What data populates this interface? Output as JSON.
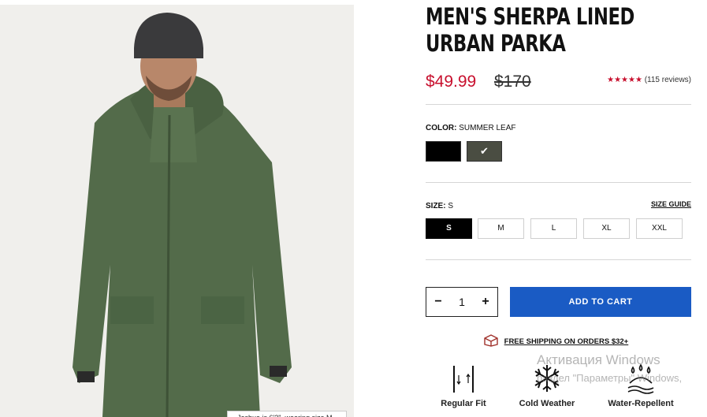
{
  "product": {
    "title_line1": "MEN'S SHERPA LINED",
    "title_line2": "URBAN PARKA",
    "price_sale": "$49.99",
    "price_original": "$170",
    "stars": "★★★★★",
    "reviews": "(115 reviews)",
    "image_caption": "Joshua is 6'2\", wearing size M"
  },
  "color": {
    "label": "COLOR:",
    "selected": "SUMMER LEAF",
    "swatches": [
      {
        "name": "black",
        "color": "#000000",
        "selected": false
      },
      {
        "name": "summer-leaf",
        "color": "#4a4d42",
        "selected": true
      }
    ],
    "check": "✔"
  },
  "size": {
    "label": "SIZE:",
    "selected": "S",
    "guide": "SIZE GUIDE",
    "options": [
      "S",
      "M",
      "L",
      "XL",
      "XXL"
    ]
  },
  "cart": {
    "qty_minus": "−",
    "qty_value": "1",
    "qty_plus": "+",
    "add_label": "ADD TO CART"
  },
  "shipping": "FREE SHIPPING ON ORDERS $32+",
  "features": [
    {
      "label": "Regular Fit",
      "icon": "regular-fit-icon"
    },
    {
      "label": "Cold Weather",
      "icon": "snowflake-icon"
    },
    {
      "label": "Water-Repellent",
      "icon": "water-repellent-icon"
    }
  ],
  "watermark": {
    "line1": "Активация Windows",
    "line2": "раздел \"Параметры\"",
    "line2_right": "Windows,"
  },
  "colors": {
    "accent": "#1a5bc4",
    "sale": "#c8102e"
  }
}
